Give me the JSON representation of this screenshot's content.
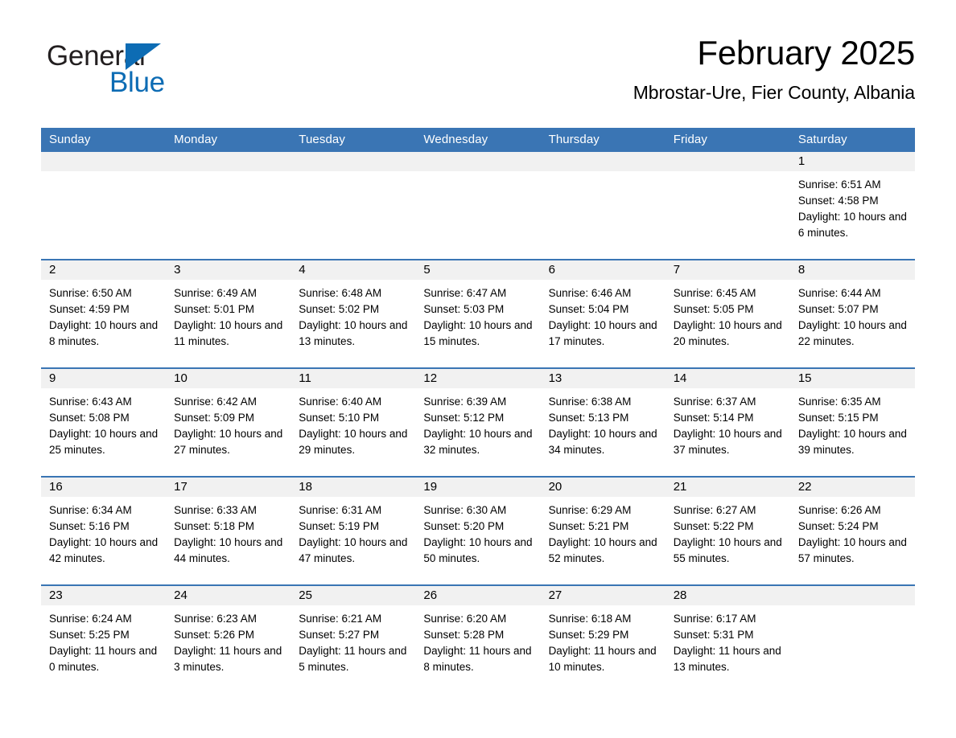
{
  "brand": {
    "name_part1": "General",
    "name_part2": "Blue",
    "flag_icon": "triangle-flag-icon",
    "color_dark": "#231f20",
    "color_blue": "#0d6cb4"
  },
  "header": {
    "title": "February 2025",
    "subtitle": "Mbrostar-Ure, Fier County, Albania"
  },
  "theme": {
    "header_row_bg": "#3a75b4",
    "daynum_band_bg": "#f1f1f1",
    "row_border": "#3a75b4",
    "text": "#000000"
  },
  "calendar": {
    "weekday_headers": [
      "Sunday",
      "Monday",
      "Tuesday",
      "Wednesday",
      "Thursday",
      "Friday",
      "Saturday"
    ],
    "weeks": [
      [
        {
          "day": "",
          "sunrise": "",
          "sunset": "",
          "daylight": ""
        },
        {
          "day": "",
          "sunrise": "",
          "sunset": "",
          "daylight": ""
        },
        {
          "day": "",
          "sunrise": "",
          "sunset": "",
          "daylight": ""
        },
        {
          "day": "",
          "sunrise": "",
          "sunset": "",
          "daylight": ""
        },
        {
          "day": "",
          "sunrise": "",
          "sunset": "",
          "daylight": ""
        },
        {
          "day": "",
          "sunrise": "",
          "sunset": "",
          "daylight": ""
        },
        {
          "day": "1",
          "sunrise": "Sunrise: 6:51 AM",
          "sunset": "Sunset: 4:58 PM",
          "daylight": "Daylight: 10 hours and 6 minutes."
        }
      ],
      [
        {
          "day": "2",
          "sunrise": "Sunrise: 6:50 AM",
          "sunset": "Sunset: 4:59 PM",
          "daylight": "Daylight: 10 hours and 8 minutes."
        },
        {
          "day": "3",
          "sunrise": "Sunrise: 6:49 AM",
          "sunset": "Sunset: 5:01 PM",
          "daylight": "Daylight: 10 hours and 11 minutes."
        },
        {
          "day": "4",
          "sunrise": "Sunrise: 6:48 AM",
          "sunset": "Sunset: 5:02 PM",
          "daylight": "Daylight: 10 hours and 13 minutes."
        },
        {
          "day": "5",
          "sunrise": "Sunrise: 6:47 AM",
          "sunset": "Sunset: 5:03 PM",
          "daylight": "Daylight: 10 hours and 15 minutes."
        },
        {
          "day": "6",
          "sunrise": "Sunrise: 6:46 AM",
          "sunset": "Sunset: 5:04 PM",
          "daylight": "Daylight: 10 hours and 17 minutes."
        },
        {
          "day": "7",
          "sunrise": "Sunrise: 6:45 AM",
          "sunset": "Sunset: 5:05 PM",
          "daylight": "Daylight: 10 hours and 20 minutes."
        },
        {
          "day": "8",
          "sunrise": "Sunrise: 6:44 AM",
          "sunset": "Sunset: 5:07 PM",
          "daylight": "Daylight: 10 hours and 22 minutes."
        }
      ],
      [
        {
          "day": "9",
          "sunrise": "Sunrise: 6:43 AM",
          "sunset": "Sunset: 5:08 PM",
          "daylight": "Daylight: 10 hours and 25 minutes."
        },
        {
          "day": "10",
          "sunrise": "Sunrise: 6:42 AM",
          "sunset": "Sunset: 5:09 PM",
          "daylight": "Daylight: 10 hours and 27 minutes."
        },
        {
          "day": "11",
          "sunrise": "Sunrise: 6:40 AM",
          "sunset": "Sunset: 5:10 PM",
          "daylight": "Daylight: 10 hours and 29 minutes."
        },
        {
          "day": "12",
          "sunrise": "Sunrise: 6:39 AM",
          "sunset": "Sunset: 5:12 PM",
          "daylight": "Daylight: 10 hours and 32 minutes."
        },
        {
          "day": "13",
          "sunrise": "Sunrise: 6:38 AM",
          "sunset": "Sunset: 5:13 PM",
          "daylight": "Daylight: 10 hours and 34 minutes."
        },
        {
          "day": "14",
          "sunrise": "Sunrise: 6:37 AM",
          "sunset": "Sunset: 5:14 PM",
          "daylight": "Daylight: 10 hours and 37 minutes."
        },
        {
          "day": "15",
          "sunrise": "Sunrise: 6:35 AM",
          "sunset": "Sunset: 5:15 PM",
          "daylight": "Daylight: 10 hours and 39 minutes."
        }
      ],
      [
        {
          "day": "16",
          "sunrise": "Sunrise: 6:34 AM",
          "sunset": "Sunset: 5:16 PM",
          "daylight": "Daylight: 10 hours and 42 minutes."
        },
        {
          "day": "17",
          "sunrise": "Sunrise: 6:33 AM",
          "sunset": "Sunset: 5:18 PM",
          "daylight": "Daylight: 10 hours and 44 minutes."
        },
        {
          "day": "18",
          "sunrise": "Sunrise: 6:31 AM",
          "sunset": "Sunset: 5:19 PM",
          "daylight": "Daylight: 10 hours and 47 minutes."
        },
        {
          "day": "19",
          "sunrise": "Sunrise: 6:30 AM",
          "sunset": "Sunset: 5:20 PM",
          "daylight": "Daylight: 10 hours and 50 minutes."
        },
        {
          "day": "20",
          "sunrise": "Sunrise: 6:29 AM",
          "sunset": "Sunset: 5:21 PM",
          "daylight": "Daylight: 10 hours and 52 minutes."
        },
        {
          "day": "21",
          "sunrise": "Sunrise: 6:27 AM",
          "sunset": "Sunset: 5:22 PM",
          "daylight": "Daylight: 10 hours and 55 minutes."
        },
        {
          "day": "22",
          "sunrise": "Sunrise: 6:26 AM",
          "sunset": "Sunset: 5:24 PM",
          "daylight": "Daylight: 10 hours and 57 minutes."
        }
      ],
      [
        {
          "day": "23",
          "sunrise": "Sunrise: 6:24 AM",
          "sunset": "Sunset: 5:25 PM",
          "daylight": "Daylight: 11 hours and 0 minutes."
        },
        {
          "day": "24",
          "sunrise": "Sunrise: 6:23 AM",
          "sunset": "Sunset: 5:26 PM",
          "daylight": "Daylight: 11 hours and 3 minutes."
        },
        {
          "day": "25",
          "sunrise": "Sunrise: 6:21 AM",
          "sunset": "Sunset: 5:27 PM",
          "daylight": "Daylight: 11 hours and 5 minutes."
        },
        {
          "day": "26",
          "sunrise": "Sunrise: 6:20 AM",
          "sunset": "Sunset: 5:28 PM",
          "daylight": "Daylight: 11 hours and 8 minutes."
        },
        {
          "day": "27",
          "sunrise": "Sunrise: 6:18 AM",
          "sunset": "Sunset: 5:29 PM",
          "daylight": "Daylight: 11 hours and 10 minutes."
        },
        {
          "day": "28",
          "sunrise": "Sunrise: 6:17 AM",
          "sunset": "Sunset: 5:31 PM",
          "daylight": "Daylight: 11 hours and 13 minutes."
        },
        {
          "day": "",
          "sunrise": "",
          "sunset": "",
          "daylight": ""
        }
      ]
    ]
  }
}
